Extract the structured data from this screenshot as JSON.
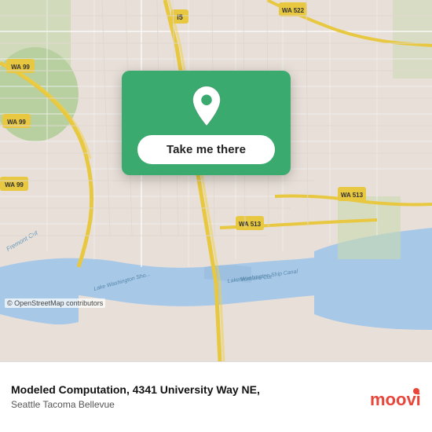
{
  "map": {
    "attribution": "© OpenStreetMap contributors",
    "background_color": "#e8e0d8"
  },
  "location_card": {
    "button_label": "Take me there",
    "pin_color": "#ffffff"
  },
  "bottom_bar": {
    "location_name": "Modeled Computation, 4341 University Way NE,",
    "location_city": "Seattle Tacoma Bellevue"
  },
  "branding": {
    "logo_text": "moovit"
  }
}
